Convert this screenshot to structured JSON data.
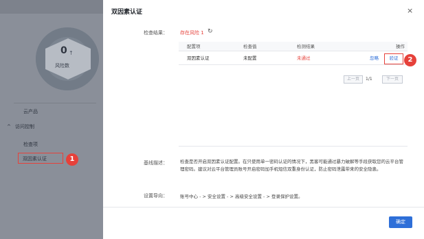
{
  "sidebar": {
    "risk_count": "0",
    "risk_arrow": "↑",
    "risk_label": "风险数",
    "cloud_product": "云产品",
    "access_control_chevron": "^",
    "access_control": "访问控制",
    "check_item": "检查项",
    "two_factor": "双因素认证"
  },
  "annotations": {
    "badge1": "1",
    "badge2": "2",
    "highlight_color": "#e6413a"
  },
  "dialog": {
    "title": "双因素认证",
    "close_icon": "×",
    "result_label": "检查结果：",
    "result_value": "存在风险 1",
    "refresh_icon": "↻",
    "table": {
      "headers": [
        "配置项",
        "检查值",
        "检测结果",
        "操作"
      ],
      "rows": [
        {
          "item": "双因素认证",
          "value": "未配置",
          "result": "未通过",
          "ignore": "忽略",
          "verify": "验证"
        }
      ]
    },
    "pager": {
      "prev": "上一页",
      "info": "1/1",
      "next": "下一页"
    },
    "baseline_label": "基线描述：",
    "baseline_desc": "检查是否开启双因素认证配置。在只使用单一密码认证的情况下，黑客可能通过暴力破解等手段获取您的云平台管理密码。建议对云平台管理员账号开启密码加手机短信双重身份认证，防止密码泄露带来的安全隐患。",
    "guide_label": "设置导向：",
    "guide_path": "账号中心 - > 安全设置 - > 高级安全设置 - > 登录保护设置。",
    "confirm": "确定"
  },
  "colors": {
    "accent": "#2e6fd8",
    "danger": "#e6413a"
  }
}
